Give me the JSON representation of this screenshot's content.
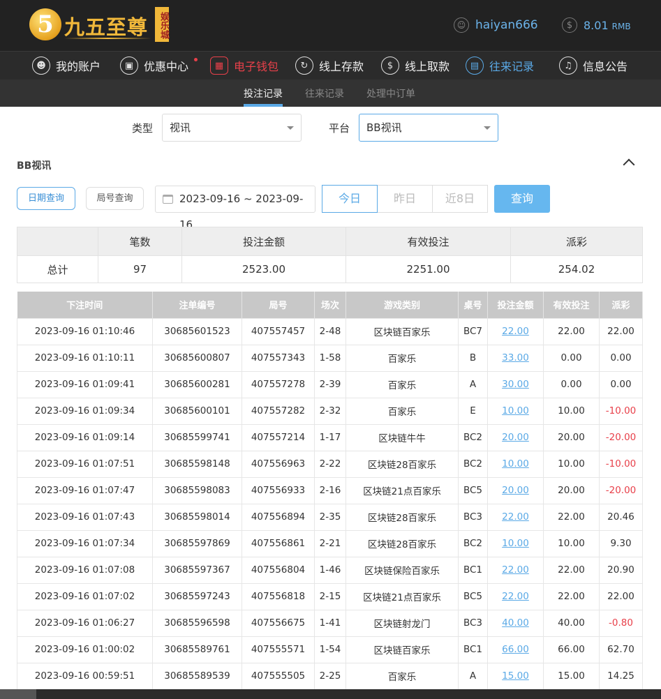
{
  "header": {
    "logo_glyph": "5",
    "logo_text": "九五至尊",
    "logo_badge": "娱乐城",
    "username": "haiyan666",
    "balance": "8.01",
    "currency": "RMB"
  },
  "nav": {
    "items": [
      {
        "label": "我的账户",
        "icon": "user-icon"
      },
      {
        "label": "优惠中心",
        "icon": "gift-icon"
      },
      {
        "label": "电子钱包",
        "icon": "wallet-icon"
      },
      {
        "label": "线上存款",
        "icon": "deposit-icon"
      },
      {
        "label": "线上取款",
        "icon": "withdraw-icon"
      },
      {
        "label": "往来记录",
        "icon": "records-icon"
      },
      {
        "label": "信息公告",
        "icon": "bell-icon"
      }
    ]
  },
  "subnav": {
    "tabs": [
      "投注记录",
      "往来记录",
      "处理中订单"
    ]
  },
  "filters": {
    "type_label": "类型",
    "type_value": "视讯",
    "platform_label": "平台",
    "platform_value": "BB视讯"
  },
  "section_title": "BB视讯",
  "query": {
    "date_query": "日期查询",
    "round_query": "局号查询",
    "date_range": "2023-09-16 ~ 2023-09-16",
    "today": "今日",
    "yesterday": "昨日",
    "last8": "近8日",
    "search": "查询"
  },
  "summary": {
    "headers": [
      "",
      "笔数",
      "投注金额",
      "有效投注",
      "派彩"
    ],
    "row": [
      "总计",
      "97",
      "2523.00",
      "2251.00",
      "254.02"
    ]
  },
  "records": {
    "headers": [
      "下注时间",
      "注单编号",
      "局号",
      "场次",
      "游戏类别",
      "桌号",
      "投注金额",
      "有效投注",
      "派彩"
    ],
    "rows": [
      [
        "2023-09-16 01:10:46",
        "30685601523",
        "407557457",
        "2-48",
        "区块链百家乐",
        "BC7",
        "22.00",
        "22.00",
        "22.00"
      ],
      [
        "2023-09-16 01:10:11",
        "30685600807",
        "407557343",
        "1-58",
        "百家乐",
        "B",
        "33.00",
        "0.00",
        "0.00"
      ],
      [
        "2023-09-16 01:09:41",
        "30685600281",
        "407557278",
        "2-39",
        "百家乐",
        "A",
        "30.00",
        "0.00",
        "0.00"
      ],
      [
        "2023-09-16 01:09:34",
        "30685600101",
        "407557282",
        "2-32",
        "百家乐",
        "E",
        "10.00",
        "10.00",
        "-10.00"
      ],
      [
        "2023-09-16 01:09:14",
        "30685599741",
        "407557214",
        "1-17",
        "区块链牛牛",
        "BC2",
        "20.00",
        "20.00",
        "-20.00"
      ],
      [
        "2023-09-16 01:07:51",
        "30685598148",
        "407556963",
        "2-22",
        "区块链28百家乐",
        "BC2",
        "10.00",
        "10.00",
        "-10.00"
      ],
      [
        "2023-09-16 01:07:47",
        "30685598083",
        "407556933",
        "2-16",
        "区块链21点百家乐",
        "BC5",
        "20.00",
        "20.00",
        "-20.00"
      ],
      [
        "2023-09-16 01:07:43",
        "30685598014",
        "407556894",
        "2-35",
        "区块链28百家乐",
        "BC3",
        "22.00",
        "22.00",
        "20.46"
      ],
      [
        "2023-09-16 01:07:34",
        "30685597869",
        "407556861",
        "2-21",
        "区块链28百家乐",
        "BC2",
        "10.00",
        "10.00",
        "9.30"
      ],
      [
        "2023-09-16 01:07:08",
        "30685597367",
        "407556804",
        "1-46",
        "区块链保险百家乐",
        "BC1",
        "22.00",
        "22.00",
        "20.90"
      ],
      [
        "2023-09-16 01:07:02",
        "30685597243",
        "407556818",
        "2-15",
        "区块链21点百家乐",
        "BC5",
        "22.00",
        "22.00",
        "22.00"
      ],
      [
        "2023-09-16 01:06:27",
        "30685596598",
        "407556675",
        "1-41",
        "区块链射龙门",
        "BC3",
        "40.00",
        "40.00",
        "-0.80"
      ],
      [
        "2023-09-16 01:00:02",
        "30685589761",
        "407555571",
        "1-54",
        "区块链百家乐",
        "BC1",
        "66.00",
        "66.00",
        "62.70"
      ],
      [
        "2023-09-16 00:59:51",
        "30685589539",
        "407555505",
        "2-25",
        "百家乐",
        "A",
        "15.00",
        "15.00",
        "14.25"
      ]
    ]
  },
  "colors": {
    "accent": "#5aa9e6",
    "negative": "#e8404a",
    "header_bg": "#222222",
    "logo_gold": "#f1b83a"
  }
}
